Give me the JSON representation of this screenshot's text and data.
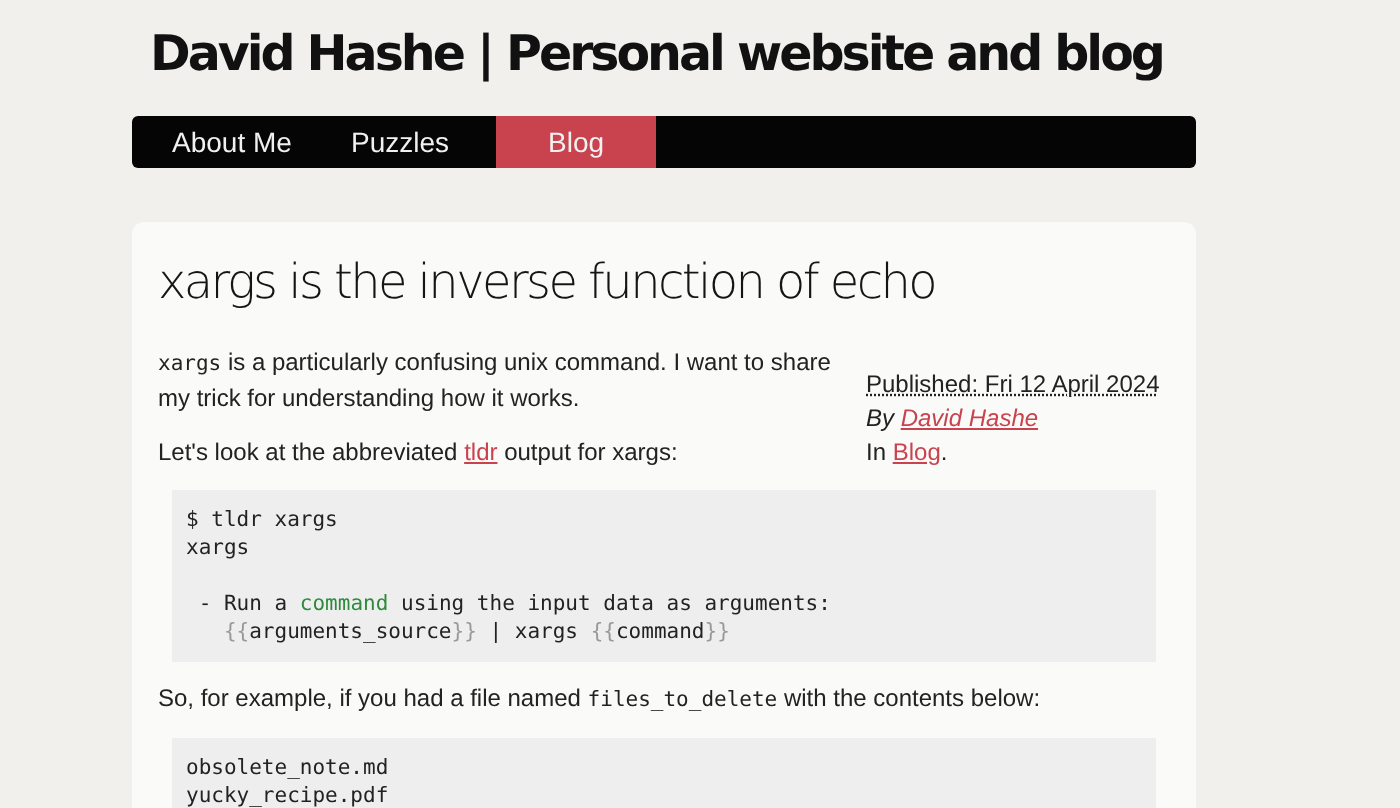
{
  "site_title": "David Hashe | Personal website and blog",
  "nav": [
    {
      "label": "About Me",
      "selected": false
    },
    {
      "label": "Puzzles",
      "selected": false
    },
    {
      "label": "Blog",
      "selected": true
    }
  ],
  "article": {
    "title": "xargs is the inverse function of echo",
    "intro": [
      [
        {
          "kind": "code",
          "text": "xargs"
        },
        {
          "kind": "text",
          "text": " is a particularly confusing unix command. I want to share my trick for understanding how it works."
        }
      ],
      [
        {
          "kind": "text",
          "text": "Let's look at the abbreviated "
        },
        {
          "kind": "link",
          "text": "tldr"
        },
        {
          "kind": "text",
          "text": " output for xargs:"
        }
      ]
    ],
    "meta": [
      [
        {
          "kind": "date",
          "text": "Published: Fri 12 April 2024"
        }
      ],
      [
        {
          "kind": "italic",
          "text": "By "
        },
        {
          "kind": "link_italic",
          "text": "David Hashe"
        }
      ],
      [
        {
          "kind": "text",
          "text": "In "
        },
        {
          "kind": "link",
          "text": "Blog"
        },
        {
          "kind": "text",
          "text": "."
        }
      ]
    ],
    "body": [
      {
        "kind": "code_block",
        "lines": [
          {
            "kind": "line",
            "segments": [
              {
                "kind": "plain",
                "text": "$ tldr xargs"
              }
            ]
          },
          {
            "kind": "line",
            "segments": [
              {
                "kind": "plain",
                "text": "xargs"
              }
            ]
          },
          {
            "kind": "blank"
          },
          {
            "kind": "line",
            "segments": [
              {
                "kind": "plain",
                "text": " - Run a "
              },
              {
                "kind": "keyword",
                "text": "command"
              },
              {
                "kind": "plain",
                "text": " using the input data as arguments:"
              }
            ]
          },
          {
            "kind": "indented",
            "segments": [
              {
                "kind": "brace",
                "text": "{{"
              },
              {
                "kind": "plain",
                "text": "arguments_source"
              },
              {
                "kind": "brace",
                "text": "}}"
              },
              {
                "kind": "plain",
                "text": " | xargs "
              },
              {
                "kind": "brace",
                "text": "{{"
              },
              {
                "kind": "plain",
                "text": "command"
              },
              {
                "kind": "brace",
                "text": "}}"
              }
            ]
          }
        ]
      },
      {
        "kind": "paragraph",
        "segments": [
          {
            "kind": "text",
            "text": "So, for example, if you had a file named "
          },
          {
            "kind": "code",
            "text": "files_to_delete"
          },
          {
            "kind": "text",
            "text": " with the contents below:"
          }
        ]
      },
      {
        "kind": "code_block",
        "lines": [
          {
            "kind": "line",
            "segments": [
              {
                "kind": "plain",
                "text": "obsolete_note.md"
              }
            ]
          },
          {
            "kind": "line",
            "segments": [
              {
                "kind": "plain",
                "text": "yucky_recipe.pdf"
              }
            ]
          }
        ]
      }
    ]
  }
}
